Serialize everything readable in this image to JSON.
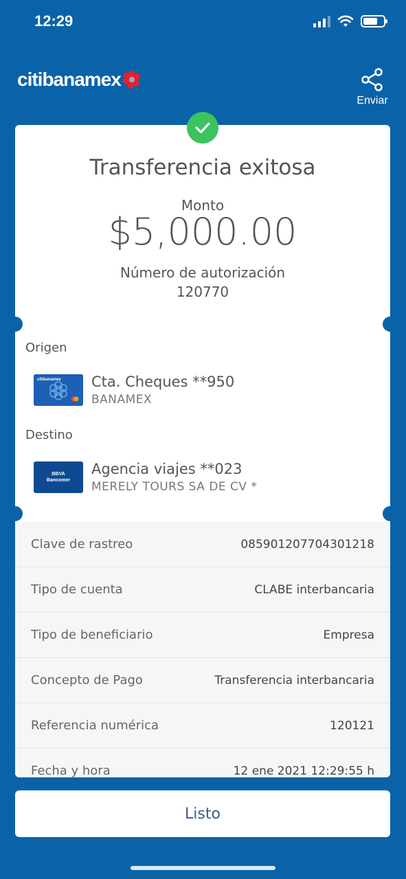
{
  "status_bar": {
    "time": "12:29"
  },
  "header": {
    "logo_text": "citibanamex",
    "share_label": "Enviar"
  },
  "receipt": {
    "title": "Transferencia exitosa",
    "amount_label": "Monto",
    "amount": "$5,000.00",
    "auth_label": "Número de autorización",
    "auth_number": "120770"
  },
  "origin": {
    "section_label": "Origen",
    "account_name": "Cta. Cheques **950",
    "bank": "BANAMEX"
  },
  "destination": {
    "section_label": "Destino",
    "account_name": "Agencia viajes **023",
    "beneficiary": "MERELY TOURS SA DE CV *",
    "bank_logo_line1": "BBVA",
    "bank_logo_line2": "Bancomer"
  },
  "details": [
    {
      "label": "Clave de rastreo",
      "value": "085901207704301218"
    },
    {
      "label": "Tipo de cuenta",
      "value": "CLABE interbancaria"
    },
    {
      "label": "Tipo de beneficiario",
      "value": "Empresa"
    },
    {
      "label": "Concepto de Pago",
      "value": "Transferencia interbancaria"
    },
    {
      "label": "Referencia numérica",
      "value": "120121"
    },
    {
      "label": "Fecha y hora",
      "value": "12 ene 2021 12:29:55 h"
    }
  ],
  "actions": {
    "done_label": "Listo"
  },
  "colors": {
    "background": "#0a63a8",
    "success": "#3cc25e",
    "logo_flower": "#e3212e",
    "button_text": "#3a5d8f"
  }
}
